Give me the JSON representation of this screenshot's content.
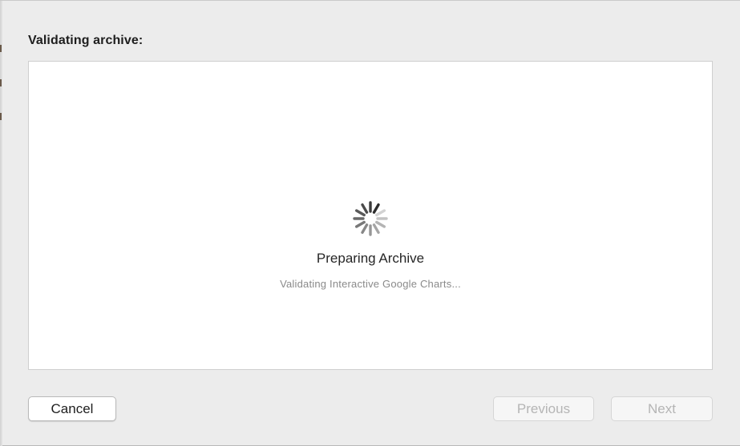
{
  "dialog": {
    "title": "Validating archive:"
  },
  "status": {
    "title": "Preparing Archive",
    "detail": "Validating Interactive Google Charts..."
  },
  "buttons": {
    "cancel": "Cancel",
    "previous": "Previous",
    "next": "Next"
  },
  "icons": {
    "spinner": "activity-spinner-icon"
  }
}
